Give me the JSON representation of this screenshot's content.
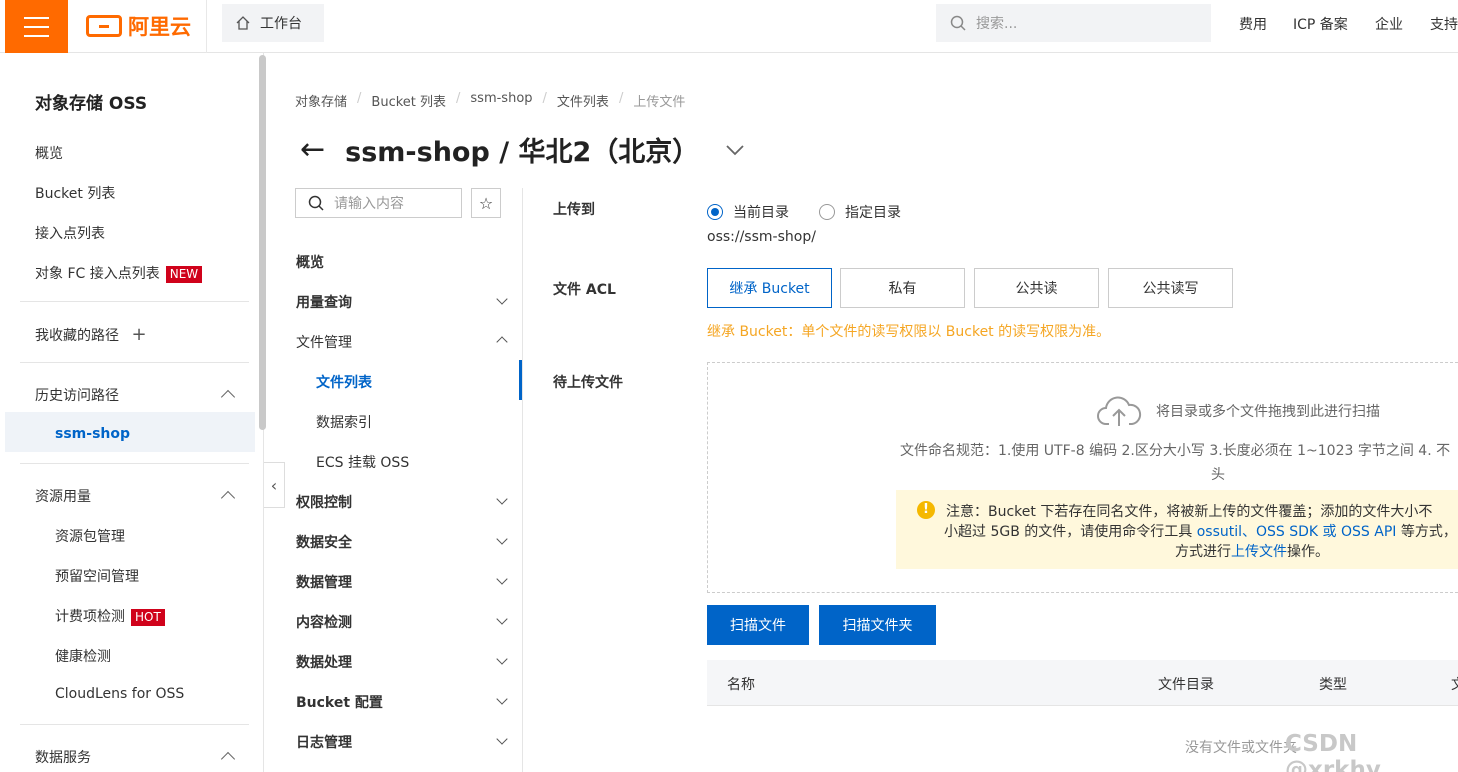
{
  "topbar": {
    "logo_text": "阿里云",
    "workbench": "工作台",
    "search_placeholder": "搜索...",
    "nav": [
      "费用",
      "ICP 备案",
      "企业",
      "支持"
    ]
  },
  "sidebar": {
    "title": "对象存储 OSS",
    "items": [
      "概览",
      "Bucket 列表",
      "接入点列表",
      "对象 FC 接入点列表"
    ],
    "new_badge": "NEW",
    "favorites": "我收藏的路径",
    "history": "历史访问路径",
    "history_item": "ssm-shop",
    "resource": "资源用量",
    "resource_items": [
      "资源包管理",
      "预留空间管理",
      "计费项检测",
      "健康检测",
      "CloudLens for OSS"
    ],
    "hot_badge": "HOT",
    "data_service": "数据服务"
  },
  "breadcrumb": [
    "对象存储",
    "Bucket 列表",
    "ssm-shop",
    "文件列表",
    "上传文件"
  ],
  "title": "ssm-shop / 华北2（北京）",
  "subnav": {
    "search_placeholder": "请输入内容",
    "items": [
      "概览",
      "用量查询",
      "文件管理",
      "文件列表",
      "数据索引",
      "ECS 挂载 OSS",
      "权限控制",
      "数据安全",
      "数据管理",
      "内容检测",
      "数据处理",
      "Bucket 配置",
      "日志管理"
    ]
  },
  "form": {
    "upload_to_label": "上传到",
    "radio_current": "当前目录",
    "radio_specified": "指定目录",
    "oss_path": "oss://ssm-shop/",
    "acl_label": "文件 ACL",
    "acl_options": [
      "继承 Bucket",
      "私有",
      "公共读",
      "公共读写"
    ],
    "acl_hint": "继承 Bucket：单个文件的读写权限以 Bucket 的读写权限为准。",
    "pending_label": "待上传文件",
    "drop_text": "将目录或多个文件拖拽到此进行扫描",
    "rule_text": "文件命名规范：1.使用 UTF-8 编码 2.区分大小写 3.长度必须在 1~1023 字节之间 4. 不",
    "rule_text2": "头",
    "notice_line1": "注意：Bucket 下若存在同名文件，将被新上传的文件覆盖；添加的文件大小不",
    "notice_line2_a": "小超过 5GB 的文件，请使用命令行工具 ",
    "notice_link1": "ossutil",
    "notice_sep1": "、",
    "notice_link2": "OSS SDK",
    "notice_or": " 或 ",
    "notice_link3": "OSS API",
    "notice_line2_b": " 等方式，",
    "notice_line3_a": "方式进行",
    "notice_link4": "上传文件",
    "notice_line3_b": "操作。",
    "scan_file": "扫描文件",
    "scan_folder": "扫描文件夹"
  },
  "table": {
    "columns": [
      "名称",
      "文件目录",
      "类型",
      "文"
    ],
    "empty": "没有文件或文件夹"
  },
  "watermark": "CSDN @xrkhy"
}
